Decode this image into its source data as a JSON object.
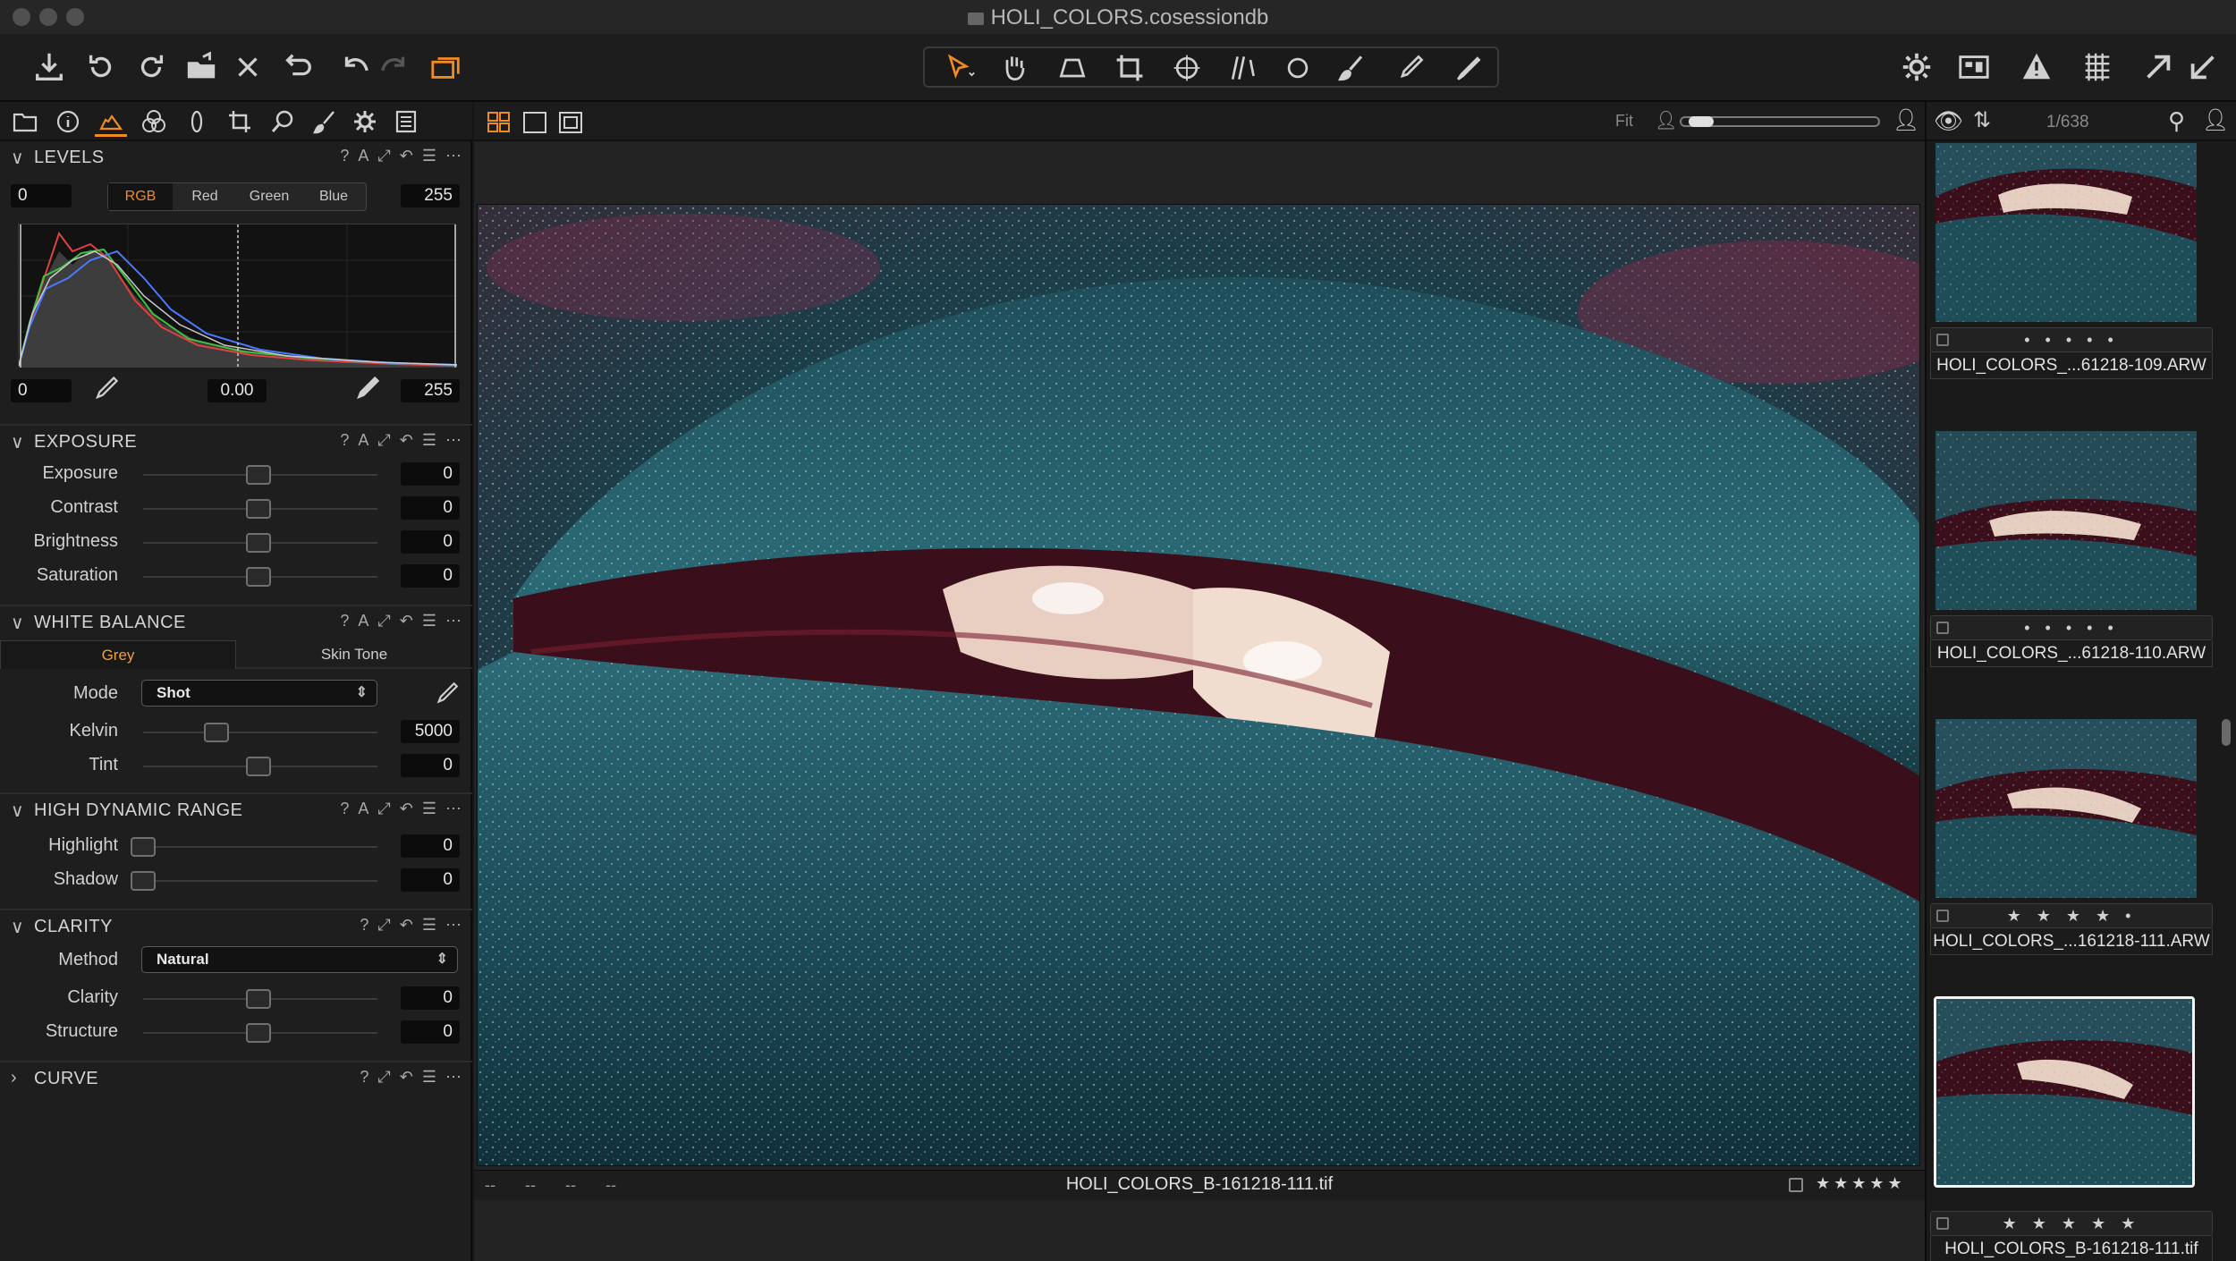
{
  "window": {
    "title": "HOLI_COLORS.cosessiondb"
  },
  "levels": {
    "title": "LEVELS",
    "input_min": "0",
    "input_max": "255",
    "channels": [
      "RGB",
      "Red",
      "Green",
      "Blue"
    ],
    "active_channel": "RGB",
    "output_min": "0",
    "midpoint": "0.00",
    "output_max": "255"
  },
  "exposure": {
    "title": "EXPOSURE",
    "sliders": [
      {
        "label": "Exposure",
        "value": "0"
      },
      {
        "label": "Contrast",
        "value": "0"
      },
      {
        "label": "Brightness",
        "value": "0"
      },
      {
        "label": "Saturation",
        "value": "0"
      }
    ]
  },
  "white_balance": {
    "title": "WHITE BALANCE",
    "tabs": [
      "Grey",
      "Skin Tone"
    ],
    "mode_label": "Mode",
    "mode_value": "Shot",
    "kelvin_label": "Kelvin",
    "kelvin_value": "5000",
    "tint_label": "Tint",
    "tint_value": "0"
  },
  "hdr": {
    "title": "HIGH DYNAMIC RANGE",
    "sliders": [
      {
        "label": "Highlight",
        "value": "0"
      },
      {
        "label": "Shadow",
        "value": "0"
      }
    ]
  },
  "clarity": {
    "title": "CLARITY",
    "method_label": "Method",
    "method_value": "Natural",
    "sliders": [
      {
        "label": "Clarity",
        "value": "0"
      },
      {
        "label": "Structure",
        "value": "0"
      }
    ]
  },
  "curve": {
    "title": "CURVE"
  },
  "viewer": {
    "zoom_label": "Fit",
    "filename": "HOLI_COLORS_B-161218-111.tif",
    "meta_placeholders": [
      "--",
      "--",
      "--",
      "--"
    ],
    "rating": "★★★★★"
  },
  "browser": {
    "counter": "1/638",
    "thumbs": [
      {
        "name": "HOLI_COLORS_...61218-109.ARW",
        "rating": "• • • • •"
      },
      {
        "name": "HOLI_COLORS_...61218-110.ARW",
        "rating": "• • • • •"
      },
      {
        "name": "HOLI_COLORS_...161218-111.ARW",
        "rating": "★ ★ ★ ★ •"
      },
      {
        "name": "HOLI_COLORS_B-161218-111.tif",
        "rating": "★ ★ ★ ★ ★"
      }
    ]
  },
  "colors": {
    "accent": "#f08a24",
    "panel_bg": "#1e1e1e",
    "lip_teal": "#1f5560",
    "lip_red": "#7a1a2a"
  }
}
